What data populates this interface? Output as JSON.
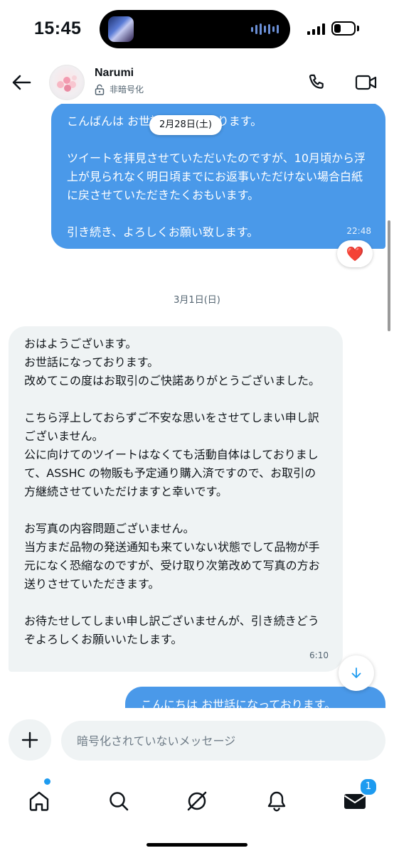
{
  "status_bar": {
    "time": "15:45",
    "battery_level": 0.35
  },
  "header": {
    "back_icon": "arrow-left-icon",
    "contact_name": "Narumi",
    "encryption_status": "非暗号化",
    "call_icon": "phone-icon",
    "video_icon": "video-camera-icon"
  },
  "messages": [
    {
      "direction": "outgoing",
      "paragraphs": [
        "こんばんは お世話になっております。",
        "ツイートを拝見させていただいたのですが、10月頃から浮上が見られなく明日頃までにお返事いただけない場合白紙に戻させていただきたくおもいます。",
        "引き続き、よろしくお願い致します。"
      ],
      "time": "22:48",
      "reaction": "❤️"
    },
    {
      "direction": "incoming",
      "paragraphs": [
        "おはようございます。\nお世話になっております。\n改めてこの度はお取引のご快諾ありがとうございました。",
        "こちら浮上しておらずご不安な思いをさせてしまい申し訳ございません。\n公に向けてのツイートはなくても活動自体はしておりまして、ASSHC の物販も予定通り購入済ですので、お取引の方継続させていただけますと幸いです。",
        "お写真の内容問題ございません。\n当方まだ品物の発送通知も来ていない状態でして品物が手元になく恐縮なのですが、受け取り次第改めて写真の方お送りさせていただきます。",
        "お待たせしてしまい申し訳ございませんが、引き続きどうぞよろしくお願いいたします。"
      ],
      "time": "6:10"
    },
    {
      "direction": "outgoing",
      "paragraphs": [
        "こんにちは お世話になっております。"
      ]
    }
  ],
  "date_labels": {
    "floating": "2月28日(土)",
    "separator": "3月1日(日)"
  },
  "composer": {
    "placeholder": "暗号化されていないメッセージ",
    "value": ""
  },
  "tabbar": {
    "items": [
      "home-icon",
      "search-icon",
      "grok-icon",
      "notifications-bell-icon",
      "messages-envelope-icon"
    ],
    "messages_badge": "1"
  },
  "colors": {
    "outgoing_bubble": "#4a99e9",
    "incoming_bubble": "#eff3f4",
    "accent": "#1d9bf0"
  }
}
